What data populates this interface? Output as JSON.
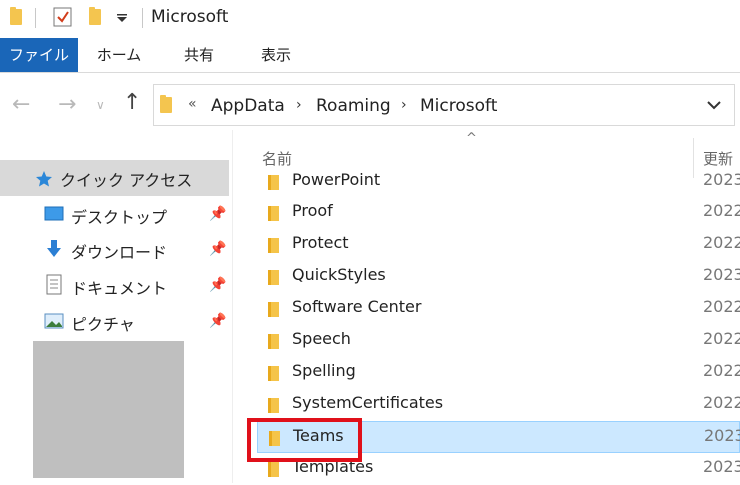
{
  "window": {
    "title": "Microsoft"
  },
  "ribbon": {
    "tabs": [
      "ファイル",
      "ホーム",
      "共有",
      "表示"
    ]
  },
  "address": {
    "overflow": "«",
    "crumbs": [
      "AppData",
      "Roaming",
      "Microsoft"
    ]
  },
  "columns": {
    "name": "名前",
    "date": "更新"
  },
  "sidebar": {
    "items": [
      {
        "label": "クイック アクセス",
        "icon": "star-icon"
      },
      {
        "label": "デスクトップ",
        "icon": "desktop-icon",
        "pinned": true
      },
      {
        "label": "ダウンロード",
        "icon": "download-icon",
        "pinned": true
      },
      {
        "label": "ドキュメント",
        "icon": "document-icon",
        "pinned": true
      },
      {
        "label": "ピクチャ",
        "icon": "pictures-icon",
        "pinned": true
      }
    ]
  },
  "files": [
    {
      "name": "PowerPoint",
      "date": "2023"
    },
    {
      "name": "Proof",
      "date": "2022"
    },
    {
      "name": "Protect",
      "date": "2022"
    },
    {
      "name": "QuickStyles",
      "date": "2023"
    },
    {
      "name": "Software Center",
      "date": "2022"
    },
    {
      "name": "Speech",
      "date": "2022"
    },
    {
      "name": "Spelling",
      "date": "2022"
    },
    {
      "name": "SystemCertificates",
      "date": "2022"
    },
    {
      "name": "Teams",
      "date": "2023",
      "selected": true
    },
    {
      "name": "Templates",
      "date": "2023"
    }
  ],
  "colors": {
    "accent": "#1a66b8",
    "selection": "#cce8ff",
    "highlight": "#e0101a",
    "folder": "#f5c449"
  }
}
